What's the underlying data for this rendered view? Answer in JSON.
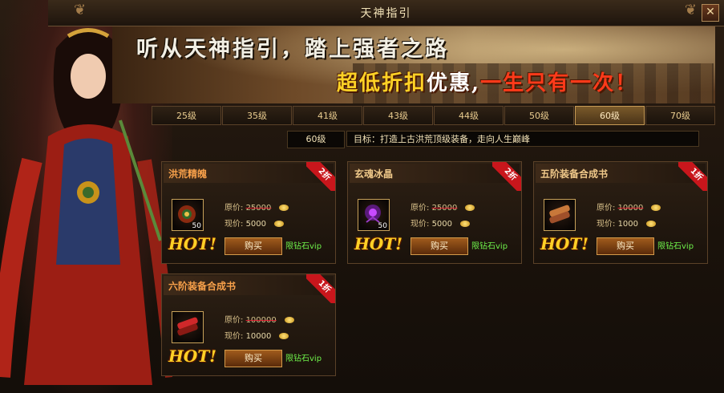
{
  "window": {
    "title": "天神指引",
    "close_label": "✕"
  },
  "banner": {
    "line1": "听从天神指引，踏上强者之路",
    "line2_part1": "超低折扣",
    "line2_part2": "优惠,",
    "line2_part3": "一生只有一次！"
  },
  "tabs": [
    {
      "label": "25级",
      "active": false
    },
    {
      "label": "35级",
      "active": false
    },
    {
      "label": "41级",
      "active": false
    },
    {
      "label": "43级",
      "active": false
    },
    {
      "label": "44级",
      "active": false
    },
    {
      "label": "50级",
      "active": false
    },
    {
      "label": "60级",
      "active": true
    },
    {
      "label": "70级",
      "active": false
    }
  ],
  "target": {
    "level": "60级",
    "text": "目标：打造上古洪荒顶级装备，走向人生巅峰"
  },
  "items": [
    {
      "name": "洪荒精魄",
      "discount": "2折",
      "orig_label": "原价:",
      "orig_price": "25000",
      "now_label": "现价:",
      "now_price": "5000",
      "qty": "50",
      "hot": "HOT!",
      "buy_label": "购买",
      "vip": "限钻石vip"
    },
    {
      "name": "玄魂冰晶",
      "discount": "2折",
      "orig_label": "原价:",
      "orig_price": "25000",
      "now_label": "现价:",
      "now_price": "5000",
      "qty": "50",
      "hot": "HOT!",
      "buy_label": "购买",
      "vip": "限钻石vip"
    },
    {
      "name": "五阶装备合成书",
      "discount": "1折",
      "orig_label": "原价:",
      "orig_price": "10000",
      "now_label": "现价:",
      "now_price": "1000",
      "qty": "",
      "hot": "HOT!",
      "buy_label": "购买",
      "vip": "限钻石vip"
    },
    {
      "name": "六阶装备合成书",
      "discount": "1折",
      "orig_label": "原价:",
      "orig_price": "100000",
      "now_label": "现价:",
      "now_price": "10000",
      "qty": "",
      "hot": "HOT!",
      "buy_label": "购买",
      "vip": "限钻石vip"
    }
  ]
}
